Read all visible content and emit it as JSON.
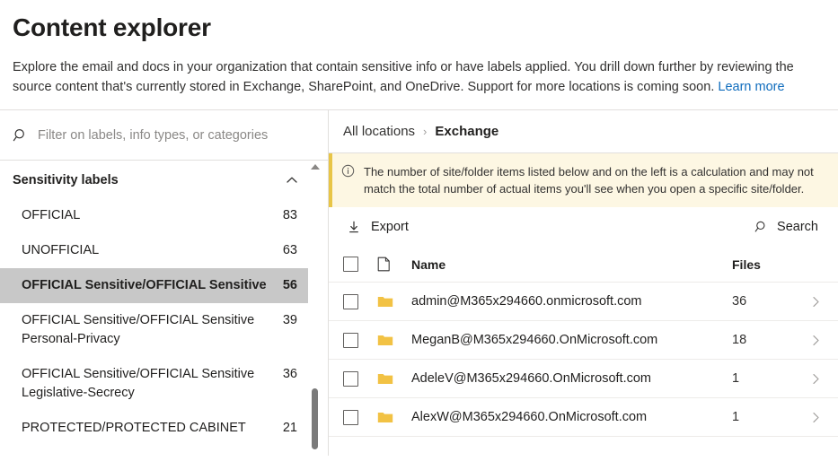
{
  "header": {
    "title": "Content explorer",
    "description_part1": "Explore the email and docs in your organization that contain sensitive info or have labels applied. You drill down further by reviewing the source content that's currently stored in Exchange, SharePoint, and OneDrive. Support for more locations is coming soon. ",
    "learn_more_label": "Learn more",
    "link_color": "#0f6cbd"
  },
  "sidebar": {
    "filter": {
      "placeholder": "Filter on labels, info types, or categories",
      "value": "",
      "icon": "search-icon"
    },
    "group": {
      "title": "Sensitivity labels",
      "collapse_icon": "chevron-up-icon"
    },
    "selected_highlight_color": "#c8c8c8",
    "items": [
      {
        "label": "OFFICIAL",
        "count": "83",
        "selected": false
      },
      {
        "label": "UNOFFICIAL",
        "count": "63",
        "selected": false
      },
      {
        "label": "OFFICIAL Sensitive/OFFICIAL Sensitive",
        "count": "56",
        "selected": true
      },
      {
        "label": "OFFICIAL Sensitive/OFFICIAL Sensitive Personal-Privacy",
        "count": "39",
        "selected": false
      },
      {
        "label": "OFFICIAL Sensitive/OFFICIAL Sensitive Legislative-Secrecy",
        "count": "36",
        "selected": false
      },
      {
        "label": "PROTECTED/PROTECTED CABINET",
        "count": "21",
        "selected": false
      }
    ]
  },
  "content": {
    "breadcrumb": {
      "root": "All locations",
      "separator": "›",
      "current": "Exchange"
    },
    "info_banner": {
      "icon": "info-circle-icon",
      "text": "The number of site/folder items listed below and on the left is a calculation and may not match the total number of actual items you'll see when you open a specific site/folder.",
      "background_color": "#fdf7e3",
      "border_color": "#e8c547"
    },
    "toolbar": {
      "export_label": "Export",
      "export_icon": "download-icon",
      "search_label": "Search",
      "search_icon": "search-icon"
    },
    "table": {
      "columns": {
        "select_all": "select-all-checkbox",
        "type_icon": "document-icon",
        "name": "Name",
        "files": "Files"
      },
      "folder_icon_color": "#f2c244",
      "rows": [
        {
          "name": "admin@M365x294660.onmicrosoft.com",
          "files": "36",
          "icon": "folder-icon",
          "checked": false
        },
        {
          "name": "MeganB@M365x294660.OnMicrosoft.com",
          "files": "18",
          "icon": "folder-icon",
          "checked": false
        },
        {
          "name": "AdeleV@M365x294660.OnMicrosoft.com",
          "files": "1",
          "icon": "folder-icon",
          "checked": false
        },
        {
          "name": "AlexW@M365x294660.OnMicrosoft.com",
          "files": "1",
          "icon": "folder-icon",
          "checked": false
        }
      ]
    }
  }
}
